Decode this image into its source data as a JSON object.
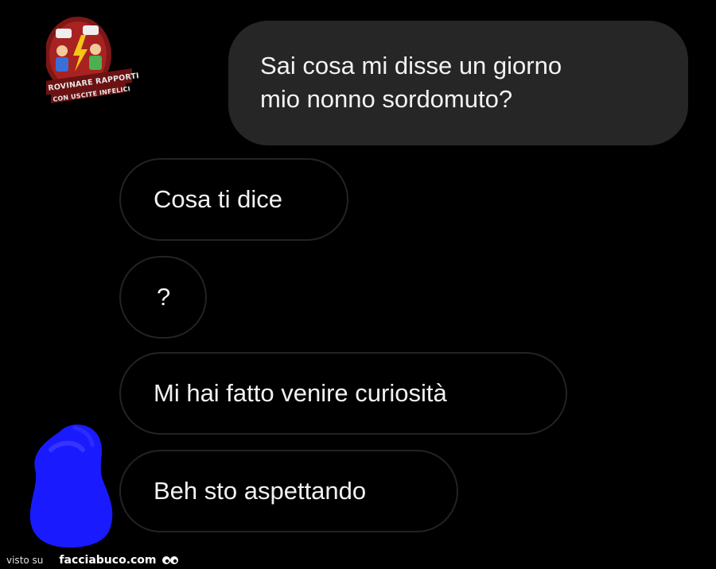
{
  "logo": {
    "line1": "ROVINARE RAPPORTI",
    "line2": "CON USCITE INFELICI",
    "icon": "two-people-lightning-badge"
  },
  "messages": {
    "outgoing": [
      {
        "line1": "Sai cosa mi disse un giorno",
        "line2": "mio nonno sordomuto?"
      }
    ],
    "incoming": [
      {
        "text": "Cosa ti dice"
      },
      {
        "text": "?"
      },
      {
        "text": "Mi hai fatto venire curiosità"
      },
      {
        "text": "Beh sto aspettando"
      }
    ]
  },
  "avatar": {
    "icon": "scribbled-avatar"
  },
  "footer": {
    "prefix": "visto su",
    "site": "facciabuco.com",
    "icon": "eyes-icon"
  },
  "colors": {
    "background": "#000000",
    "outgoing_bubble": "#262626",
    "incoming_border": "#232323",
    "avatar_scribble": "#1a1aff",
    "logo_red": "#8b1a1a"
  }
}
